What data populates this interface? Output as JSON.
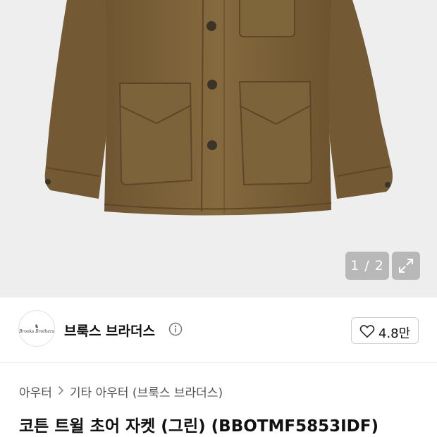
{
  "gallery": {
    "current": "1",
    "separator": "/",
    "total": "2",
    "counter_text": "1 / 2",
    "expand_icon": "expand-arrows-icon",
    "background_color": "#eeeeee",
    "product_color": "#7a6238"
  },
  "brand": {
    "logo_icon": "brand-logo",
    "logo_alt_text": "Brooks Brothers",
    "name": "브룩스 브라더스",
    "info_icon": "info-circle-icon"
  },
  "like": {
    "icon": "heart-outline-icon",
    "count": "4.8만"
  },
  "breadcrumb": {
    "items": [
      "아우터",
      "기타 아우터 (브룩스 브라더스)"
    ],
    "separator_icon": "chevron-right-icon"
  },
  "product": {
    "title": "코튼 트윌 초어 자켓 (그린) (BBOTMF5853IDF)"
  }
}
